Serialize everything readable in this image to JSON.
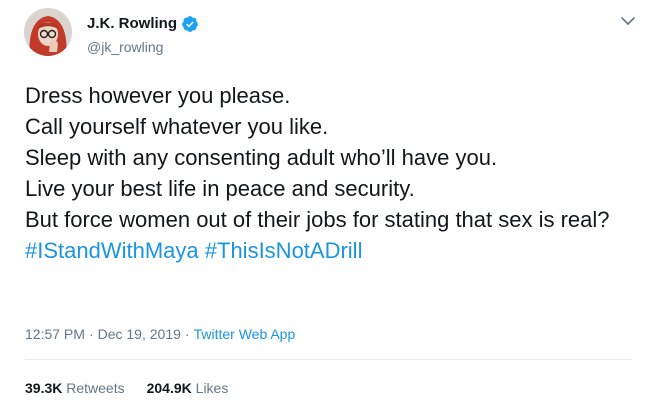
{
  "author": {
    "display_name": "J.K. Rowling",
    "handle": "@jk_rowling",
    "verified": true,
    "avatar_icon": "avatar-photo"
  },
  "tweet": {
    "lines": [
      "Dress however you please.",
      "Call yourself whatever you like.",
      "Sleep with any consenting adult who’ll have you.",
      "Live your best life in peace and security.",
      "But force women out of their jobs for stating that sex is real?"
    ],
    "hashtags": [
      "#IStandWithMaya",
      "#ThisIsNotADrill"
    ]
  },
  "meta": {
    "time": "12:57 PM",
    "separator": "·",
    "date": "Dec 19, 2019",
    "source": "Twitter Web App"
  },
  "stats": {
    "retweets_count": "39.3K",
    "retweets_label": "Retweets",
    "likes_count": "204.9K",
    "likes_label": "Likes"
  },
  "colors": {
    "text": "#14171a",
    "secondary": "#657786",
    "link": "#1b95e0",
    "verified": "#1da1f2",
    "divider": "#e6ecf0"
  }
}
